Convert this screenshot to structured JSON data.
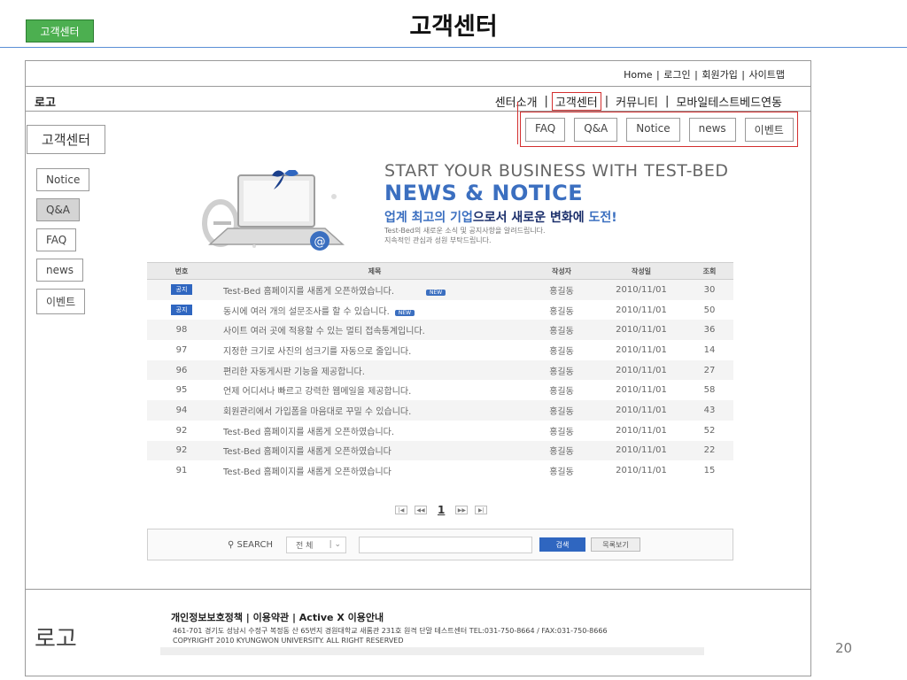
{
  "slide": {
    "tag": "고객센터",
    "title": "고객센터",
    "page_number": "20"
  },
  "util_nav": [
    "Home",
    "로그인",
    "회원가입",
    "사이트맵"
  ],
  "logo_top": "로고",
  "gnb": [
    "센터소개",
    "고객센터",
    "커뮤니티",
    "모바일테스트베드연동"
  ],
  "sub_menu": [
    "FAQ",
    "Q&A",
    "Notice",
    "news",
    "이벤트"
  ],
  "section_title": "고객센터",
  "lnb": [
    "Notice",
    "Q&A",
    "FAQ",
    "news",
    "이벤트"
  ],
  "banner": {
    "h1": "START YOUR BUSINESS WITH TEST-BED",
    "h2": "NEWS & NOTICE",
    "h3_a": "업계 최고의 기업",
    "h3_b": "으로서 새로운 변화에 ",
    "h3_c": "도전!",
    "p1": "Test-Bed의 새로운 소식 및 공지사항을 알려드립니다.",
    "p2": "지속적인 관심과 성원 부탁드립니다."
  },
  "board": {
    "headers": [
      "번호",
      "제목",
      "작성자",
      "작성일",
      "조회"
    ],
    "rows": [
      {
        "no": "공지",
        "title": "Test-Bed 홈페이지를 새롭게 오픈하였습니다.",
        "new": "NEW",
        "writer": "홍길동",
        "date": "2010/11/01",
        "hits": "30"
      },
      {
        "no": "공지",
        "title": "동시에 여러 개의 설문조사를 할 수 있습니다.",
        "new": "NEW",
        "writer": "홍길동",
        "date": "2010/11/01",
        "hits": "50"
      },
      {
        "no": "98",
        "title": "사이트 여러 곳에 적용할 수 있는 멀티 접속통계입니다.",
        "writer": "홍길동",
        "date": "2010/11/01",
        "hits": "36"
      },
      {
        "no": "97",
        "title": "지정한 크기로 사진의 섬크기를 자동으로 줄입니다.",
        "writer": "홍길동",
        "date": "2010/11/01",
        "hits": "14"
      },
      {
        "no": "96",
        "title": "편리한 자동게시판 기능을 제공합니다.",
        "writer": "홍길동",
        "date": "2010/11/01",
        "hits": "27"
      },
      {
        "no": "95",
        "title": "언제 어디서나 빠르고 강력한 웹메일을 제공합니다.",
        "writer": "홍길동",
        "date": "2010/11/01",
        "hits": "58"
      },
      {
        "no": "94",
        "title": "회원관리에서 가입폼을 마음대로 꾸밀 수 있습니다.",
        "writer": "홍길동",
        "date": "2010/11/01",
        "hits": "43"
      },
      {
        "no": "92",
        "title": "Test-Bed 홈페이지를 새롭게 오픈하였습니다.",
        "writer": "홍길동",
        "date": "2010/11/01",
        "hits": "52"
      },
      {
        "no": "92",
        "title": "Test-Bed 홈페이지를 새롭게 오픈하였습니다",
        "writer": "홍길동",
        "date": "2010/11/01",
        "hits": "22"
      },
      {
        "no": "91",
        "title": "Test-Bed 홈페이지를 새롭게 오픈하였습니다",
        "writer": "홍길동",
        "date": "2010/11/01",
        "hits": "15"
      }
    ]
  },
  "pager": {
    "current": "1",
    "first": "|◀",
    "prev": "◀◀",
    "next": "▶▶",
    "last": "▶|"
  },
  "search": {
    "label": "SEARCH",
    "select": "전 체",
    "button": "검색",
    "list_button": "목록보기"
  },
  "footer": {
    "logo": "로고",
    "links": "개인정보보호정책 | 이용약관 | Active X 이용안내",
    "address": "461-701 경기도 성남시 수정구 복정동 산 65번지 경원대학교 새롬관 231호 원격 단말 테스트센터 TEL:031-750-8664 / FAX:031-750-8666",
    "copyright": "COPYRIGHT 2010 KYUNGWON UNIVERSITY. ALL RIGHT RESERVED"
  }
}
